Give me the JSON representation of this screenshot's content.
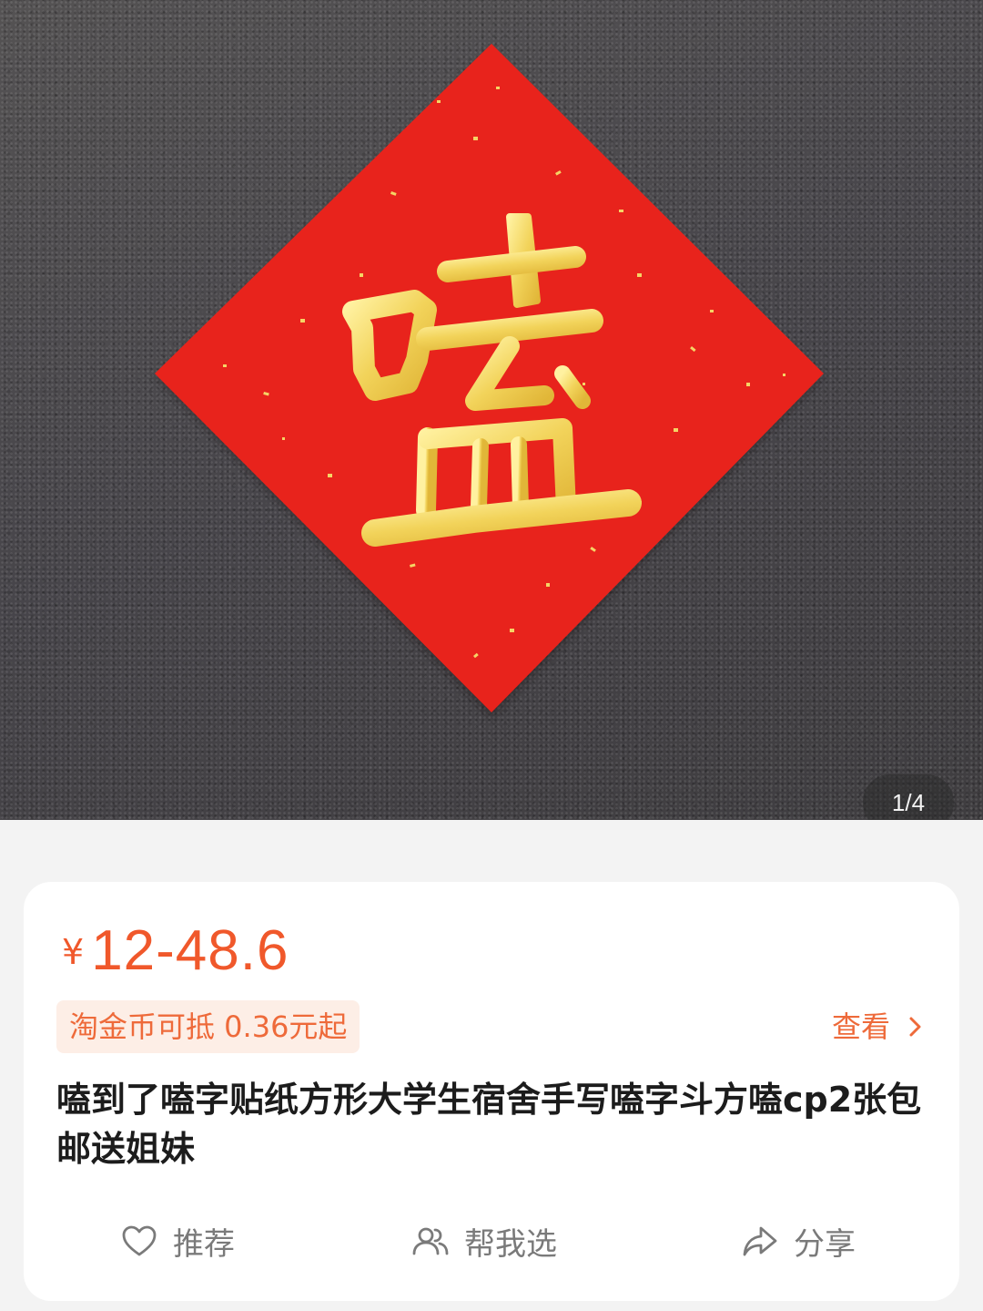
{
  "gallery": {
    "page_indicator": "1/4",
    "image_subject": "红色斗方纸 金色手写字",
    "image_character": "嗑"
  },
  "product": {
    "currency_symbol": "¥",
    "price_range": "12-48.6",
    "coin_deduction": "淘金币可抵 0.36元起",
    "view_label": "查看",
    "title": "嗑到了嗑字贴纸方形大学生宿舍手写嗑字斗方嗑cp2张包邮送姐妹"
  },
  "actions": {
    "recommend": "推荐",
    "help_choose": "帮我选",
    "share": "分享"
  },
  "colors": {
    "price": "#f0582b",
    "accent": "#ee6a3a",
    "coin_tag_bg": "#fdeee6",
    "paper_red": "#e8231c",
    "gold": "#f2d35a"
  }
}
